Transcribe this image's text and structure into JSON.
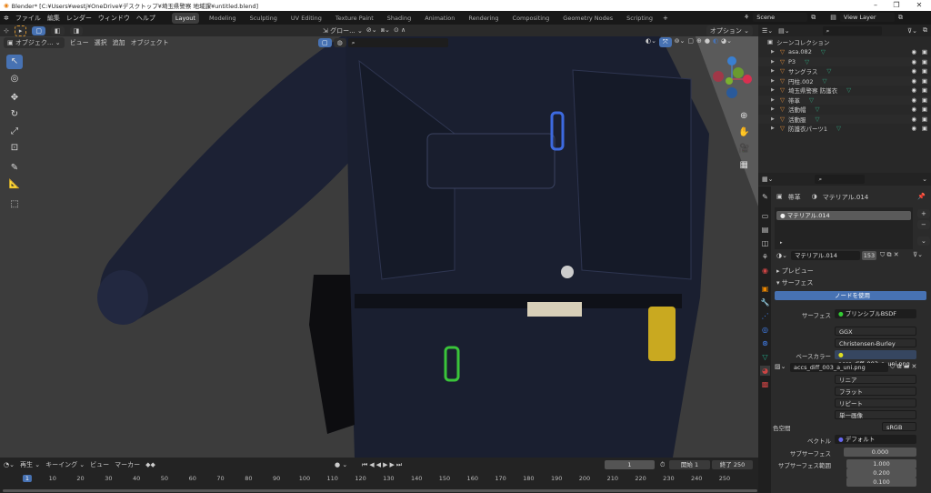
{
  "title": "Blender* [C:¥Users¥westj¥OneDrive¥デスクトップ¥埼玉県警察 地域課¥untitled.blend]",
  "menu": [
    "ファイル",
    "編集",
    "レンダー",
    "ウィンドウ",
    "ヘルプ"
  ],
  "workspaces": [
    "Layout",
    "Modeling",
    "Sculpting",
    "UV Editing",
    "Texture Paint",
    "Shading",
    "Animation",
    "Rendering",
    "Compositing",
    "Geometry Nodes",
    "Scripting"
  ],
  "scene": "Scene",
  "view_layer": "View Layer",
  "viewport": {
    "mode": "オブジェク...",
    "menus": [
      "ビュー",
      "選択",
      "追加",
      "オブジェクト"
    ],
    "transform": "グロー...",
    "options": "オプション"
  },
  "outliner": {
    "root": "シーンコレクション",
    "items": [
      "asa.082",
      "P3",
      "サングラス",
      "円柱.002",
      "埼玉県警察 防護衣",
      "帯革",
      "活動帽",
      "活動服",
      "防護衣パーツ1"
    ]
  },
  "properties": {
    "breadcrumb_obj": "帯革",
    "breadcrumb_mat": "マテリアル.014",
    "slot": "マテリアル.014",
    "material": "マテリアル.014",
    "users": "153",
    "preview": "プレビュー",
    "surface_panel": "サーフェス",
    "use_nodes": "ノードを使用",
    "surface_label": "サーフェス",
    "surface_value": "プリンシプルBSDF",
    "distribution": "GGX",
    "subsurface_method": "Christensen-Burley",
    "base_color_label": "ベースカラー",
    "base_color_value": "accs_diff_003_a_uni.png",
    "image": "accs_diff_003_a_uni.png",
    "interp": "リニア",
    "projection": "フラット",
    "extension": "リピート",
    "source": "単一画像",
    "colorspace_label": "色空間",
    "colorspace": "sRGB",
    "vector_label": "ベクトル",
    "vector": "デフォルト",
    "subsurface_label": "サブサーフェス",
    "subsurface": "0.000",
    "radius_label": "サブサーフェス範囲",
    "radius": [
      "1.000",
      "0.200",
      "0.100"
    ]
  },
  "timeline": {
    "menus": [
      "再生",
      "キーイング",
      "ビュー",
      "マーカー"
    ],
    "current": "1",
    "start_label": "開始",
    "start": "1",
    "end_label": "終了",
    "end": "250",
    "ticks": [
      "1",
      "10",
      "20",
      "30",
      "40",
      "50",
      "60",
      "70",
      "80",
      "90",
      "100",
      "110",
      "120",
      "130",
      "140",
      "150",
      "160",
      "170",
      "180",
      "190",
      "200",
      "210",
      "220",
      "230",
      "240",
      "250"
    ]
  }
}
